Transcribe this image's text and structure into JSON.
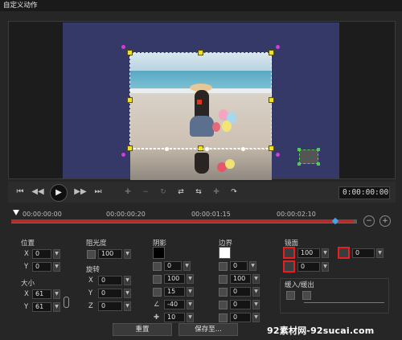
{
  "window": {
    "title": "自定义动作"
  },
  "transport": {
    "timecode": "0:00:00:00",
    "buttons": [
      "previous-frame",
      "step-back",
      "play",
      "step-forward",
      "next-frame"
    ]
  },
  "timeline": {
    "ticks": [
      "00:00:00:00",
      "00:00:00:20",
      "00:00:01:15",
      "00:00:02:10"
    ],
    "progress_fraction": 0.99
  },
  "position": {
    "label": "位置",
    "x": "0",
    "y": "0"
  },
  "size": {
    "label": "大小",
    "x": "61",
    "y": "61"
  },
  "opacity": {
    "label": "阻光度",
    "value": "100"
  },
  "rotation": {
    "label": "旋转",
    "x": "0",
    "y": "0",
    "z": "0"
  },
  "shadow": {
    "label": "阴影",
    "color": "#000000",
    "values": [
      "0",
      "100",
      "15",
      "-40",
      "10"
    ]
  },
  "border": {
    "label": "边界",
    "color": "#ffffff",
    "values": [
      "0",
      "100",
      "0",
      "0",
      "0"
    ]
  },
  "mirror": {
    "label": "镜面",
    "opacity": "100",
    "distance": "0",
    "offset": "0"
  },
  "fade": {
    "label": "缓入/缓出"
  },
  "footer": {
    "reset": "重置",
    "save": "保存至..."
  },
  "watermark": "92素材网-92sucai.com",
  "axis_labels": {
    "x": "X",
    "y": "Y",
    "z": "Z"
  }
}
